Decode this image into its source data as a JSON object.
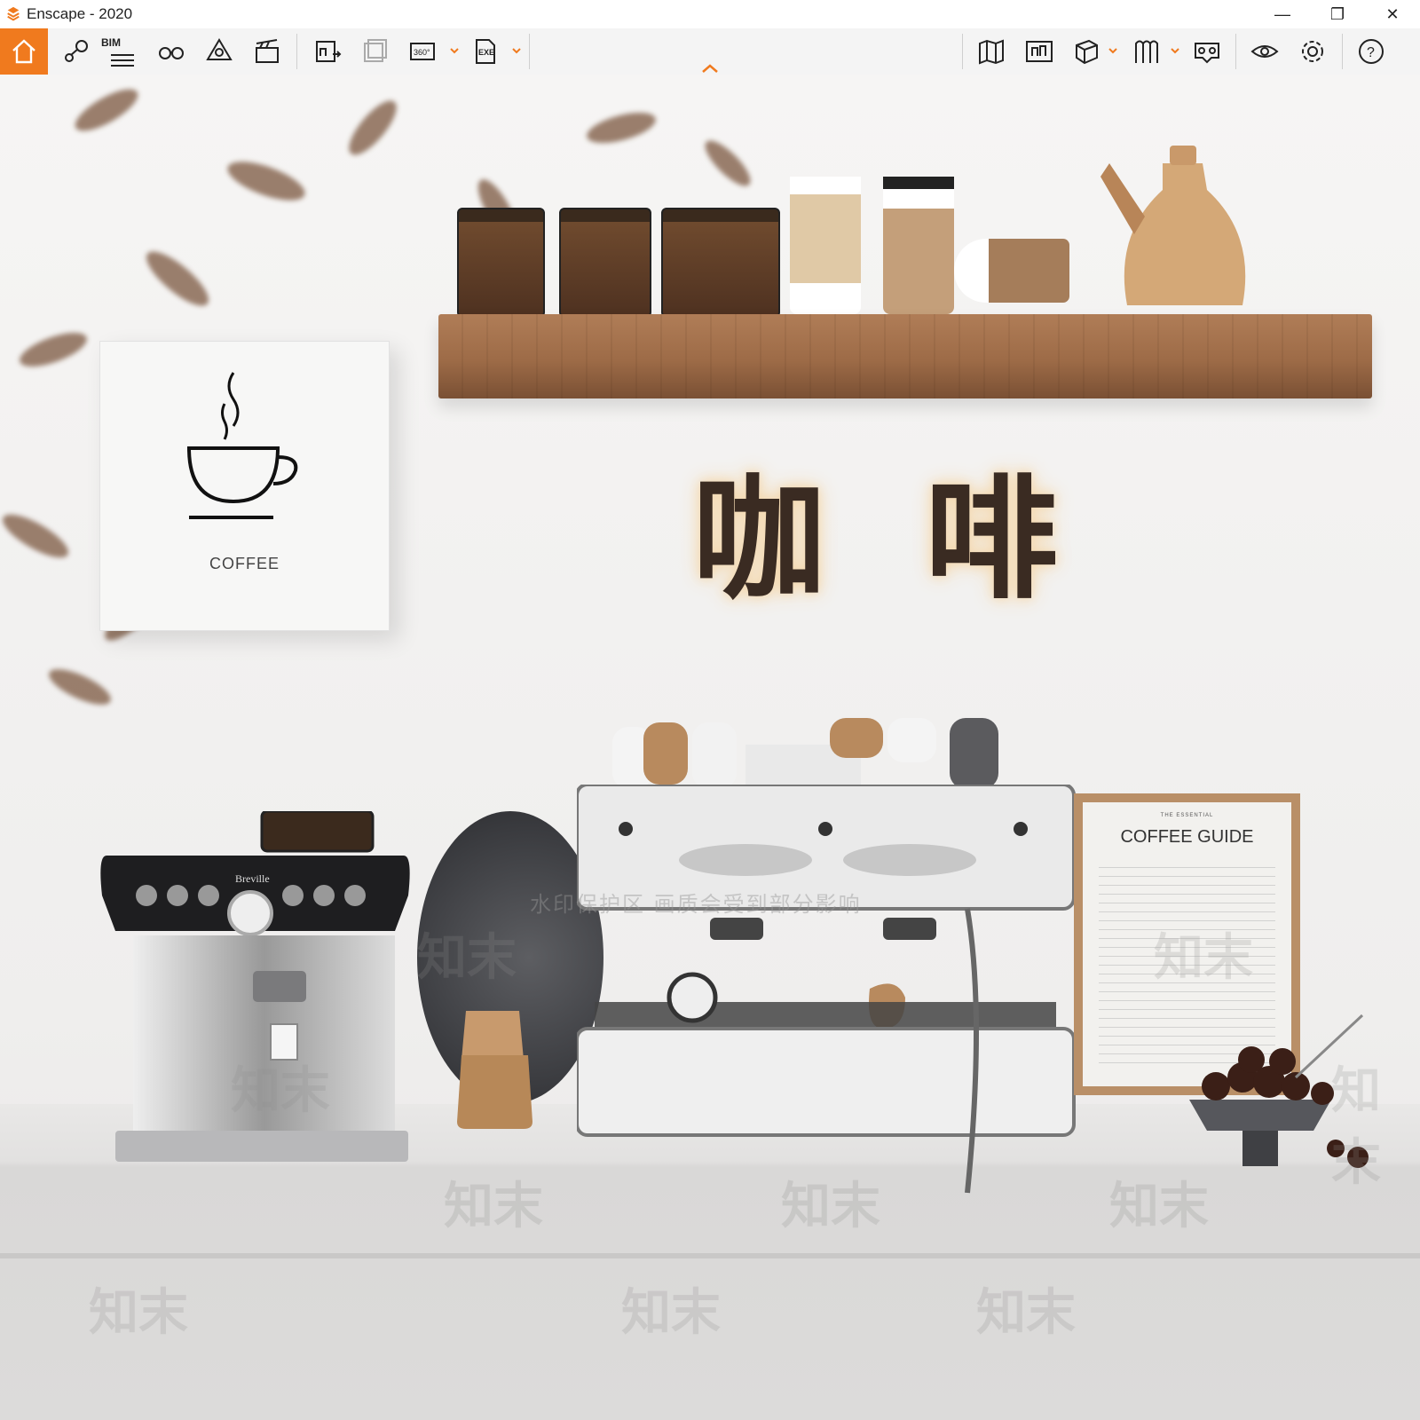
{
  "window": {
    "title": "Enscape - 2020",
    "controls": [
      "—",
      "❐",
      "✕"
    ]
  },
  "toolbar": {
    "bim_label": "BIM",
    "left_tools": [
      "home-icon",
      "pin-icon",
      "bim-list-icon",
      "binoculars-icon",
      "light-icon",
      "clapper-icon",
      "export-image-icon",
      "batch-render-icon",
      "360-icon",
      "exe-icon"
    ],
    "right_tools": [
      "map-icon",
      "views-icon",
      "cube-icon",
      "asset-icon",
      "vr-icon",
      "visual-settings-icon",
      "settings-icon",
      "help-icon"
    ],
    "label_360": "360°",
    "label_exe": "EXE",
    "accent": "#f07a1e"
  },
  "scene": {
    "panel_label": "COFFEE",
    "neon_sign": "咖 啡",
    "guide_kicker": "THE ESSENTIAL",
    "guide_title": "COFFEE GUIDE",
    "brand": "Breville",
    "watermark_char": "知末",
    "watermark_note": "水印保护区  画质会受到部分影响"
  }
}
